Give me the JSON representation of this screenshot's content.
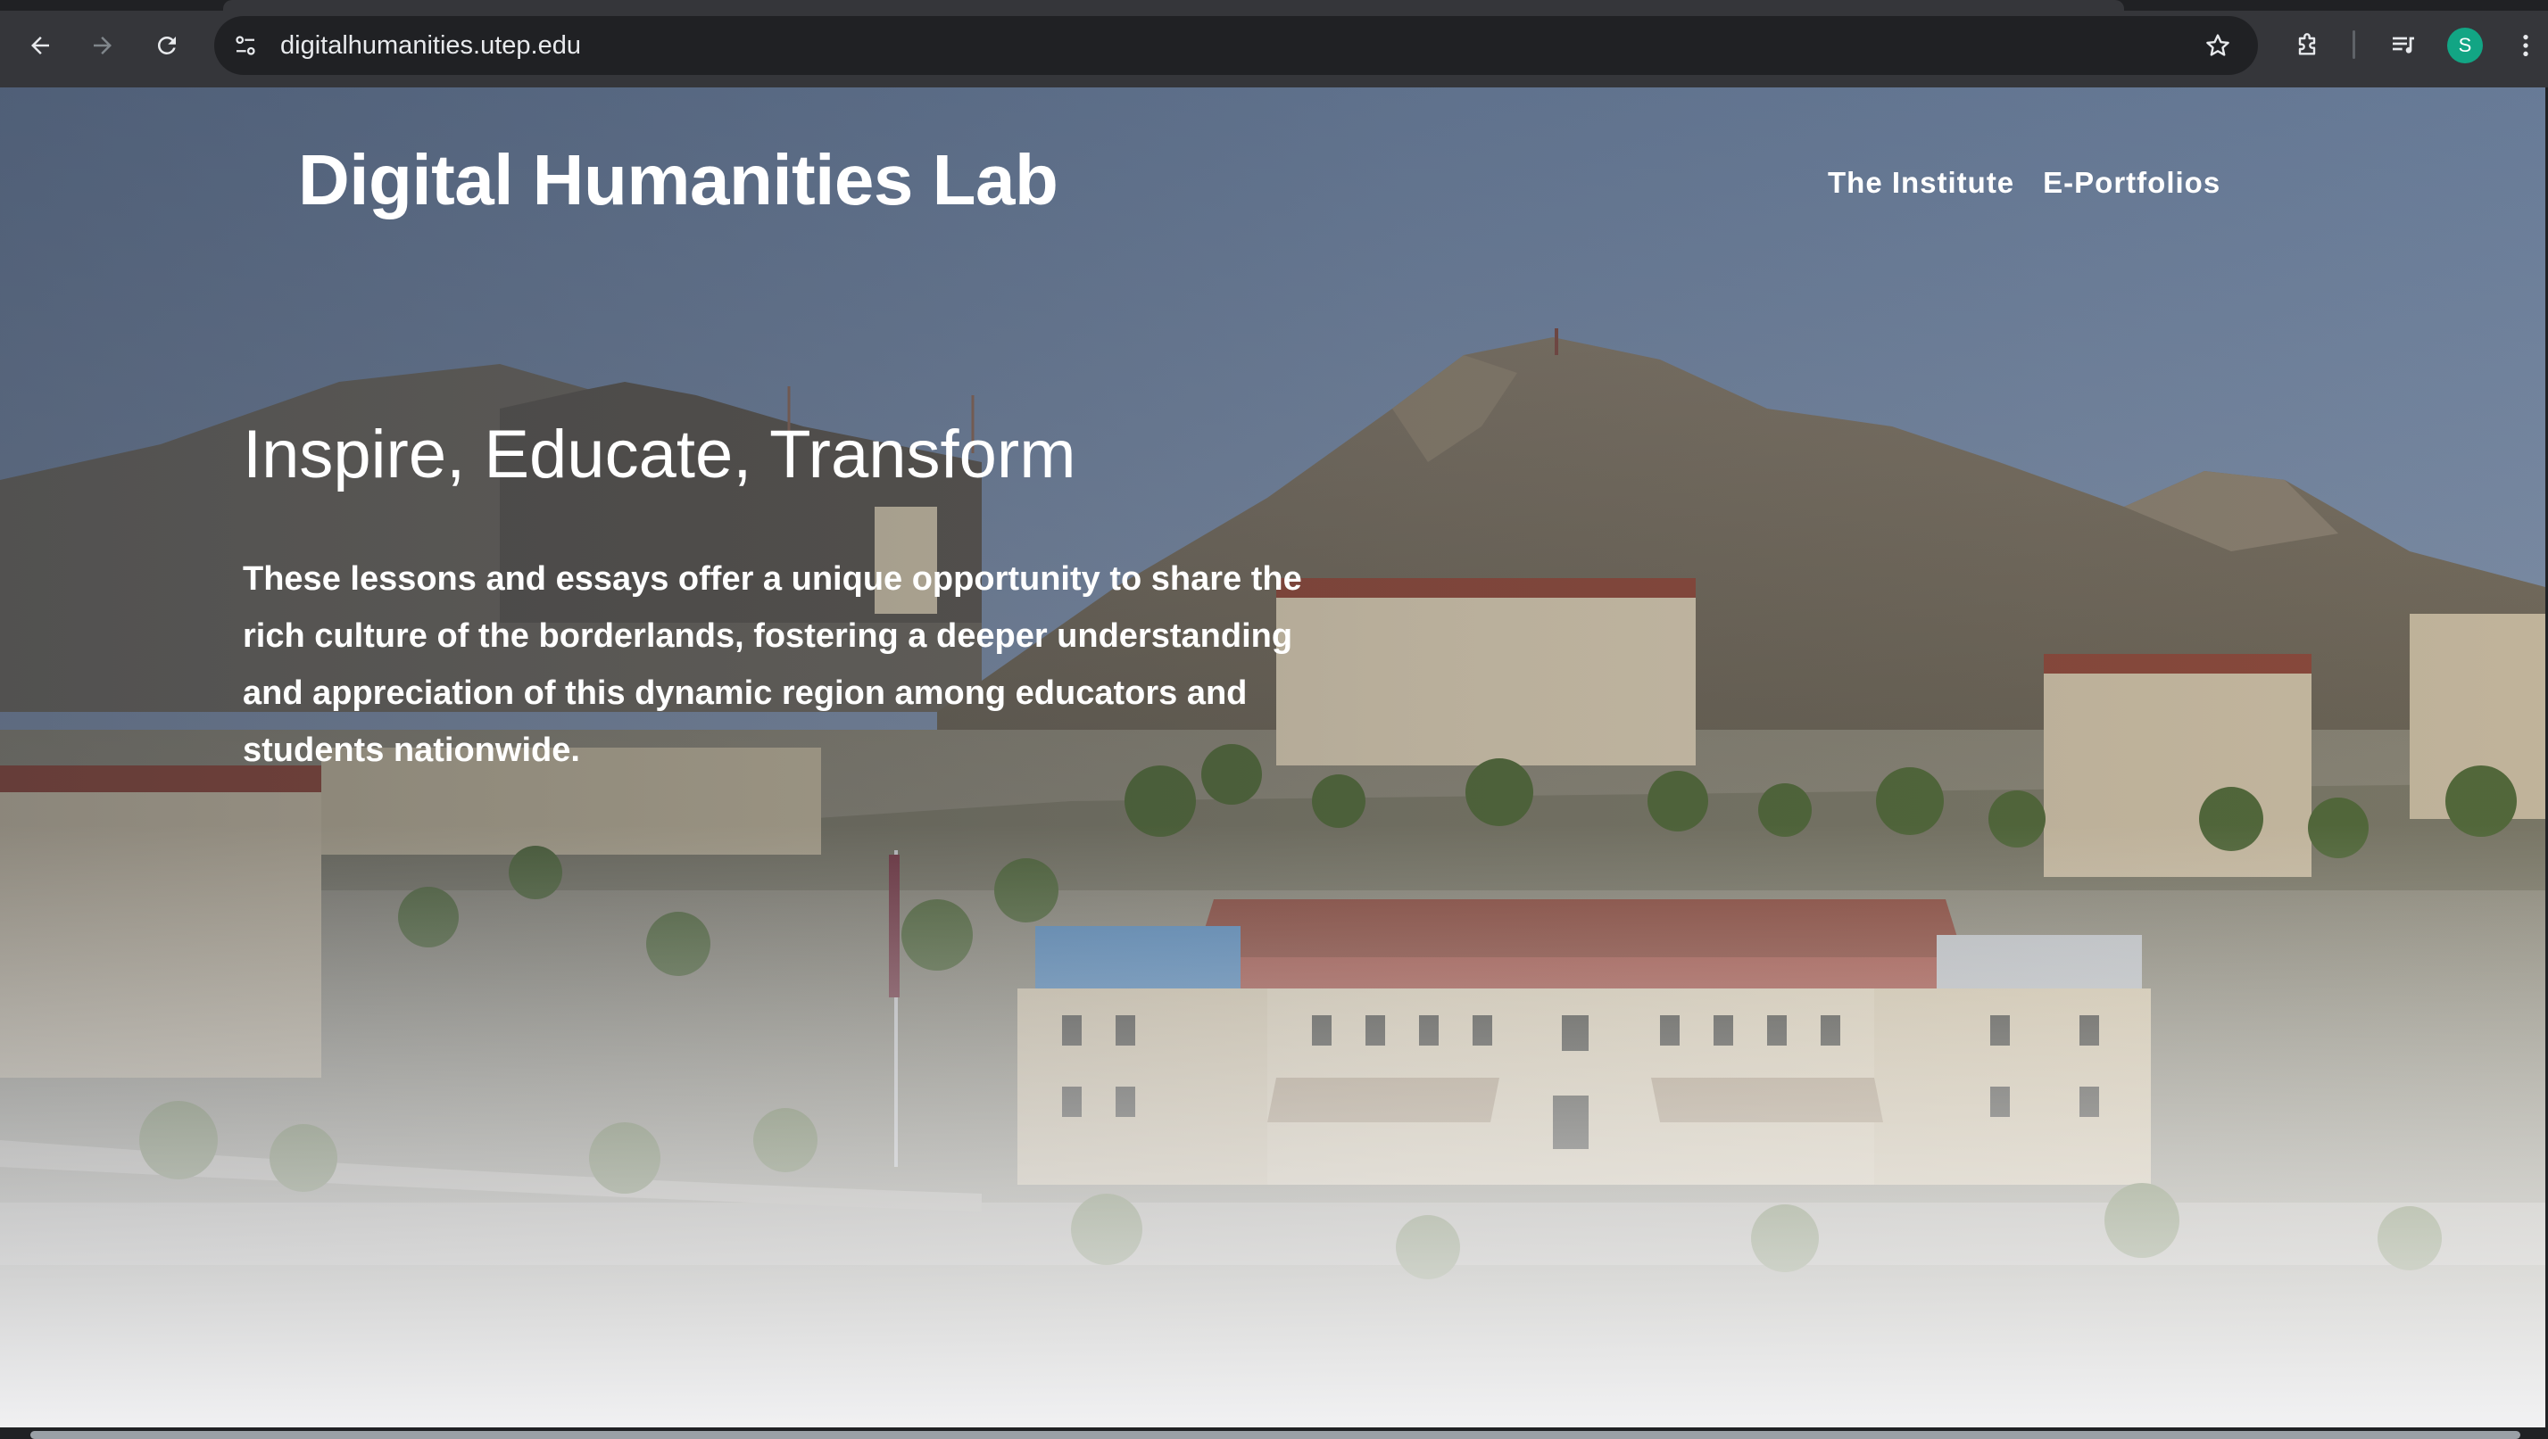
{
  "browser": {
    "url": "digitalhumanities.utep.edu",
    "profile_initial": "S",
    "icons": {
      "back": "arrow-left-icon",
      "forward": "arrow-right-icon",
      "reload": "reload-icon",
      "site_info": "tune-icon",
      "bookmark": "star-icon",
      "extensions": "puzzle-icon",
      "media": "playlist-music-icon",
      "menu": "kebab-menu-icon"
    },
    "colors": {
      "frame": "#35363a",
      "omnibox": "#202124",
      "avatar": "#12a584"
    }
  },
  "page": {
    "site_title": "Digital Humanities Lab",
    "nav": [
      {
        "label": "The Institute"
      },
      {
        "label": "E-Portfolios"
      }
    ],
    "hero": {
      "heading": "Inspire, Educate, Transform",
      "body": "These lessons and essays offer a unique opportunity to share the rich culture of the borderlands, fostering a deeper understanding and appreciation of this dynamic region among educators and students nationwide."
    }
  }
}
